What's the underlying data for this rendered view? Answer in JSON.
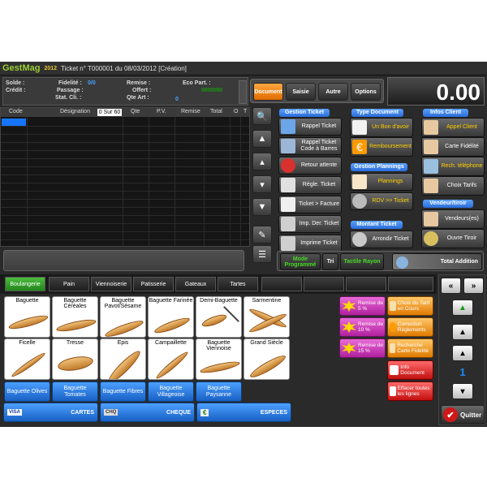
{
  "titlebar": {
    "brand": "GestMag",
    "year": "2012",
    "doc_title": "Ticket n° T000001 du 08/03/2012   [Création]"
  },
  "info": {
    "solde_label": "Solde :",
    "credit_label": "Crédit :",
    "fidelite_label": "Fidelité :",
    "fidelite_value": "0/0",
    "passage_label": "Passage :",
    "stat_label": "Stat. Cli. :",
    "remise_label": "Remise :",
    "offert_label": "Offert :",
    "qte_label": "Qte Art :",
    "qte_value": "0",
    "eco_label": "Eco Part. :"
  },
  "top_tabs": [
    {
      "label": "Document",
      "active": true
    },
    {
      "label": "Saisie",
      "active": false
    },
    {
      "label": "Autre",
      "active": false
    },
    {
      "label": "Options",
      "active": false
    }
  ],
  "total": "0.00",
  "grid": {
    "columns": [
      "Code",
      "Désignation",
      "Qte",
      "P.V.",
      "Remise",
      "Total",
      "O",
      "T"
    ],
    "filter": "0 Sur 60"
  },
  "panels": {
    "gestion_ticket": {
      "title": "Gestion Ticket",
      "buttons": [
        "Rappel Ticket",
        "Rappel Ticket Code à Barres",
        "Retour attente",
        "Régle. Ticket",
        "Ticket > Facture",
        "Imp. Der. Ticket",
        "Imprime Ticket"
      ]
    },
    "type_document": {
      "title": "Type Document",
      "buttons": [
        "Un Bon d'avoir",
        "Remboursement"
      ]
    },
    "gestion_plannings": {
      "title": "Gestion Plannings",
      "buttons": [
        "Plannings",
        "RDV >> Ticket"
      ]
    },
    "montant_ticket": {
      "title": "Montant Ticket",
      "buttons": [
        "Arrondir Ticket"
      ]
    },
    "infos_client": {
      "title": "Infos Client",
      "buttons": [
        "Appel Client",
        "Carte Fidélité",
        "Rech. téléphone",
        "Choix Tarifs"
      ]
    },
    "vendeur_tiroir": {
      "title": "Vendeur/tiroir",
      "buttons": [
        "Vendeurs(es)",
        "Ouvre Tiroir"
      ]
    }
  },
  "mode_bar": {
    "mode": "Mode Programmé",
    "tri": "Tri",
    "tactile": "Tactile Rayon",
    "total_addition": "Total Addition"
  },
  "categories": [
    {
      "label": "Boulangerie",
      "active": true
    },
    {
      "label": "Pain",
      "active": false
    },
    {
      "label": "Viennoiserie",
      "active": false
    },
    {
      "label": "Patisserie",
      "active": false
    },
    {
      "label": "Gateaux",
      "active": false
    },
    {
      "label": "Tartes",
      "active": false
    }
  ],
  "products": [
    {
      "name": "Baguette"
    },
    {
      "name": "Baguette Céréales"
    },
    {
      "name": "Baguette Pavot/Sésame"
    },
    {
      "name": "Baguette Farinée"
    },
    {
      "name": "Demi-Baguette"
    },
    {
      "name": "Sarmentine"
    },
    {
      "name": "Ficelle"
    },
    {
      "name": "Tresse"
    },
    {
      "name": "Epis"
    },
    {
      "name": "Campaillette"
    },
    {
      "name": "Baguette Viennoise"
    },
    {
      "name": "Grand Siècle"
    }
  ],
  "products_blue": [
    "Baguette Olives",
    "Baguette Tomates",
    "Baguette Fibres",
    "Baguette Villageoise",
    "Baguette Paysanne"
  ],
  "payments": [
    {
      "icon": "VISA",
      "label": "CARTES"
    },
    {
      "icon": "CHQ",
      "label": "CHEQUE"
    },
    {
      "icon": "€",
      "label": "ESPECES"
    }
  ],
  "remises": [
    "Remise de 5 %",
    "Remise de 10 %",
    "Remise de 15 %"
  ],
  "actions": [
    "Choix du Tarif en Cours",
    "Correction Règlements",
    "Recherche Carte Fidélité",
    "Info Document",
    "Effacer toutes les lignes"
  ],
  "rightnav": {
    "page": "1",
    "quit": "Quitter"
  }
}
